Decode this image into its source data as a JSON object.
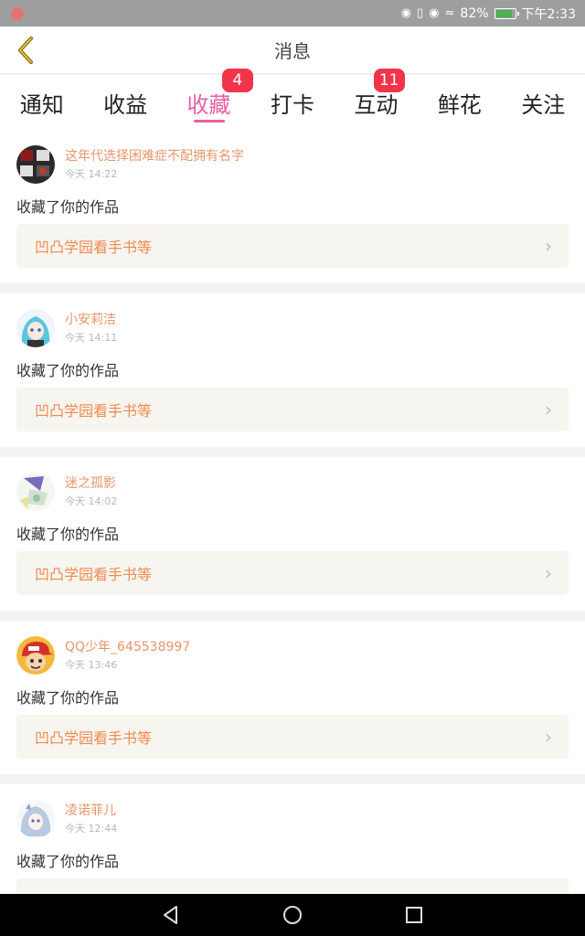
{
  "status_bar": {
    "battery": "82%",
    "time": "下午2:33"
  },
  "header": {
    "title": "消息"
  },
  "tabs": [
    {
      "label": "通知",
      "badge": ""
    },
    {
      "label": "收益",
      "badge": ""
    },
    {
      "label": "收藏",
      "badge": "4"
    },
    {
      "label": "打卡",
      "badge": ""
    },
    {
      "label": "互动",
      "badge": "11"
    },
    {
      "label": "鲜花",
      "badge": ""
    },
    {
      "label": "关注",
      "badge": ""
    }
  ],
  "active_tab": "收藏",
  "messages": [
    {
      "user": "这年代选择困难症不配拥有名字",
      "time": "今天 14:22",
      "action": "收藏了你的作品",
      "work": "凹凸学园看手书等"
    },
    {
      "user": "小安莉洁",
      "time": "今天 14:11",
      "action": "收藏了你的作品",
      "work": "凹凸学园看手书等"
    },
    {
      "user": "迷之孤影",
      "time": "今天 14:02",
      "action": "收藏了你的作品",
      "work": "凹凸学园看手书等"
    },
    {
      "user": "QQ少年_645538997",
      "time": "今天 13:46",
      "action": "收藏了你的作品",
      "work": "凹凸学园看手书等"
    },
    {
      "user": "凌诺菲儿",
      "time": "今天 12:44",
      "action": "收藏了你的作品",
      "work": ""
    }
  ],
  "colors": {
    "accent": "#e85fa0",
    "badge": "#f2344b",
    "username": "#e8956a",
    "work_title": "#f08a50"
  }
}
